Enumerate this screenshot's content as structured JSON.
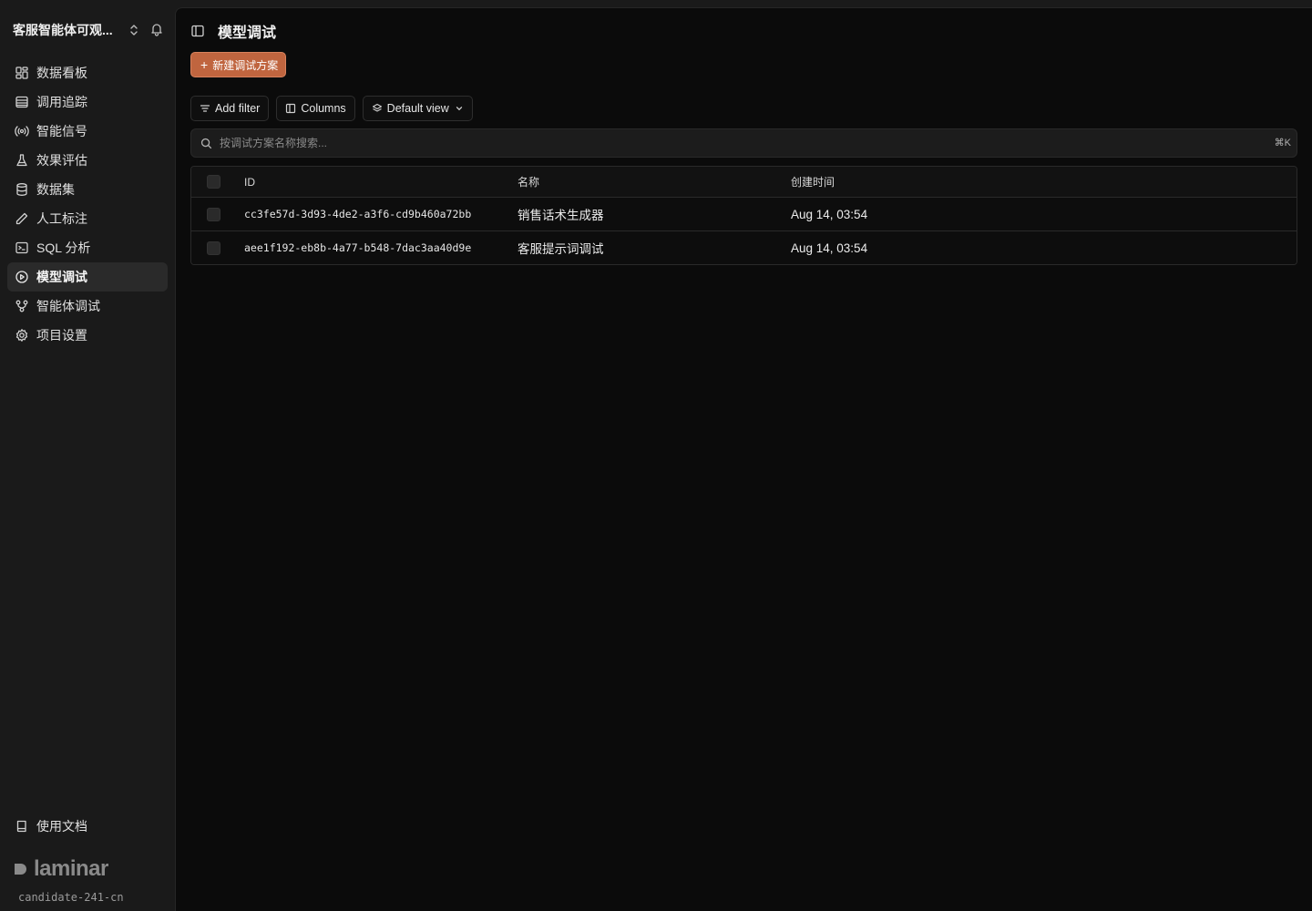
{
  "sidebar": {
    "project_name": "客服智能体可观...",
    "items": [
      {
        "label": "数据看板",
        "icon": "dashboard-icon",
        "active": false
      },
      {
        "label": "调用追踪",
        "icon": "list-icon",
        "active": false
      },
      {
        "label": "智能信号",
        "icon": "signal-icon",
        "active": false
      },
      {
        "label": "效果评估",
        "icon": "flask-icon",
        "active": false
      },
      {
        "label": "数据集",
        "icon": "database-icon",
        "active": false
      },
      {
        "label": "人工标注",
        "icon": "pencil-icon",
        "active": false
      },
      {
        "label": "SQL 分析",
        "icon": "terminal-icon",
        "active": false
      },
      {
        "label": "模型调试",
        "icon": "play-circle-icon",
        "active": true
      },
      {
        "label": "智能体调试",
        "icon": "workflow-icon",
        "active": false
      },
      {
        "label": "项目设置",
        "icon": "gear-icon",
        "active": false
      }
    ],
    "docs_label": "使用文档",
    "brand": "laminar",
    "user": "candidate-241-cn"
  },
  "main": {
    "title": "模型调试",
    "new_button": "新建调试方案",
    "toolbar": {
      "add_filter": "Add filter",
      "columns": "Columns",
      "view": "Default view"
    },
    "search": {
      "placeholder": "按调试方案名称搜索...",
      "shortcut": "⌘K"
    },
    "table": {
      "columns": [
        "ID",
        "名称",
        "创建时间"
      ],
      "rows": [
        {
          "id": "cc3fe57d-3d93-4de2-a3f6-cd9b460a72bb",
          "name": "销售话术生成器",
          "created": "Aug 14, 03:54"
        },
        {
          "id": "aee1f192-eb8b-4a77-b548-7dac3aa40d9e",
          "name": "客服提示词调试",
          "created": "Aug 14, 03:54"
        }
      ]
    }
  },
  "colors": {
    "accent": "#c0653f",
    "sidebar_bg": "#1a1a1a",
    "main_bg": "#0b0b0b"
  }
}
